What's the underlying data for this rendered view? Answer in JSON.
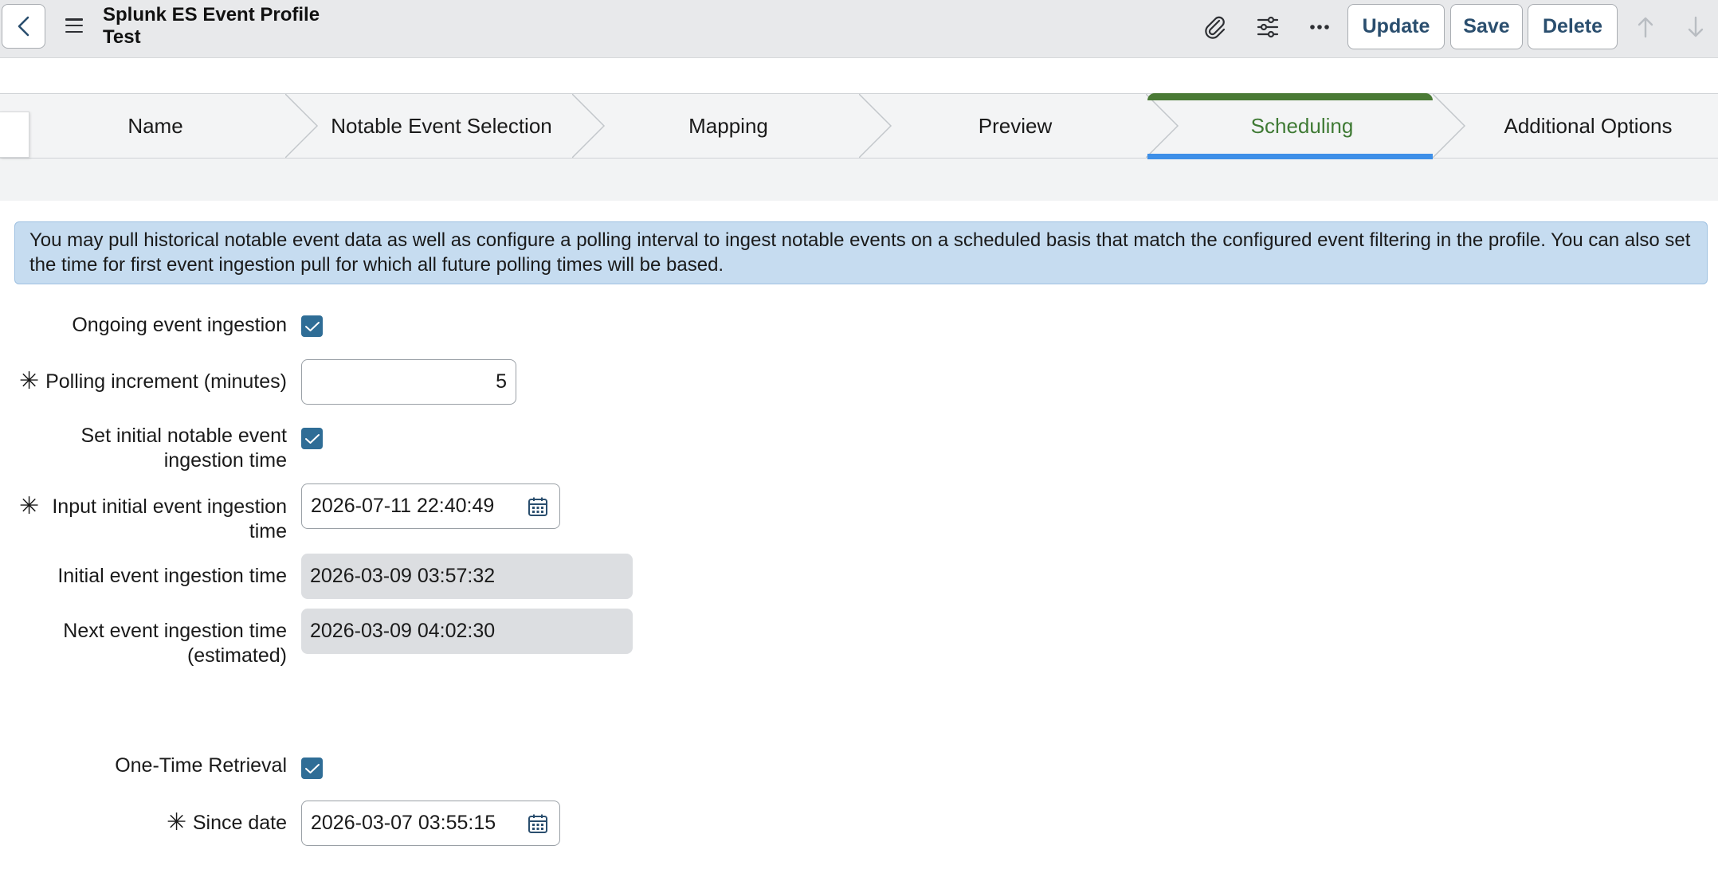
{
  "header": {
    "title_line1": "Splunk ES Event Profile",
    "title_line2": "Test",
    "buttons": {
      "update": "Update",
      "save": "Save",
      "delete": "Delete"
    }
  },
  "stepper": {
    "steps": [
      {
        "label": "Name"
      },
      {
        "label": "Notable Event Selection"
      },
      {
        "label": "Mapping"
      },
      {
        "label": "Preview"
      },
      {
        "label": "Scheduling"
      },
      {
        "label": "Additional Options"
      }
    ],
    "active": "Scheduling"
  },
  "info_message": "You may pull historical notable event data as well as configure a polling interval to ingest notable events on a scheduled basis that match the configured event filtering in the profile. You can also set the time for first event ingestion pull for which all future polling times will be based.",
  "form": {
    "ongoing_ingestion": {
      "label": "Ongoing event ingestion",
      "checked": true
    },
    "polling_increment": {
      "label": "Polling increment (minutes)",
      "value": "5",
      "required": true
    },
    "set_initial_time": {
      "label_line1": "Set initial notable event",
      "label_line2": "ingestion time",
      "checked": true
    },
    "input_initial_time": {
      "label_line1": "Input initial event ingestion",
      "label_line2": "time",
      "value": "2026-07-11 22:40:49",
      "required": true
    },
    "initial_time": {
      "label": "Initial event ingestion time",
      "value": "2026-03-09 03:57:32"
    },
    "next_time": {
      "label_line1": "Next event ingestion time",
      "label_line2": "(estimated)",
      "value": "2026-03-09 04:02:30"
    },
    "one_time_retrieval": {
      "label": "One-Time Retrieval",
      "checked": true
    },
    "since_date": {
      "label": "Since date",
      "value": "2026-03-07 03:55:15",
      "required": true
    }
  },
  "colors": {
    "accent_green": "#4a7a35",
    "accent_blue": "#3d8fe8",
    "checkbox": "#2f6d96",
    "info_bg": "#c6dcf0"
  }
}
